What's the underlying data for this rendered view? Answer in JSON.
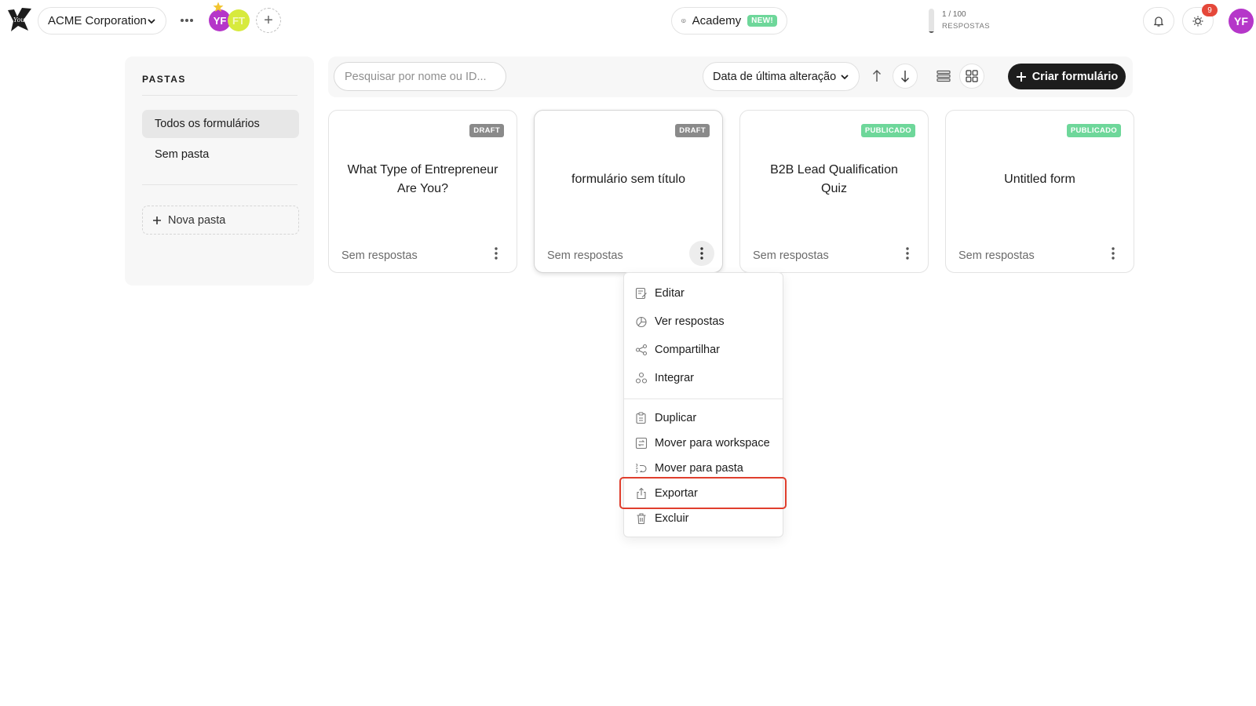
{
  "header": {
    "workspace_name": "ACME Corporation",
    "members": [
      {
        "initials": "YF",
        "color": "#b536c9"
      },
      {
        "initials": "FT",
        "color": "#d7ea3d"
      }
    ],
    "add_member_symbol": "+",
    "academy_label": "Academy",
    "academy_badge": "NEW!",
    "usage": {
      "count_text": "1 / 100",
      "label": "RESPOSTAS",
      "used": 1,
      "limit": 100
    },
    "notification_count": "9",
    "user_initials": "YF"
  },
  "folders": {
    "title": "PASTAS",
    "items": [
      {
        "label": "Todos os formulários",
        "active": true
      },
      {
        "label": "Sem pasta",
        "active": false
      }
    ],
    "new_folder_label": "Nova pasta"
  },
  "toolbar": {
    "search_placeholder": "Pesquisar por nome ou ID...",
    "sort_label": "Data de última alteração",
    "create_label": "Criar formulário"
  },
  "forms": [
    {
      "title": "What Type of Entrepreneur Are You?",
      "status": "DRAFT",
      "responses": "Sem respostas"
    },
    {
      "title": "formulário sem título",
      "status": "DRAFT",
      "responses": "Sem respostas"
    },
    {
      "title": "B2B Lead Qualification Quiz",
      "status": "PUBLICADO",
      "responses": "Sem respostas"
    },
    {
      "title": "Untitled form",
      "status": "PUBLICADO",
      "responses": "Sem respostas"
    }
  ],
  "context_menu": {
    "group1": [
      {
        "label": "Editar",
        "icon": "edit-icon"
      },
      {
        "label": "Ver respostas",
        "icon": "pie-chart-icon"
      },
      {
        "label": "Compartilhar",
        "icon": "share-icon"
      },
      {
        "label": "Integrar",
        "icon": "integrate-icon"
      }
    ],
    "group2": [
      {
        "label": "Duplicar",
        "icon": "duplicate-icon"
      },
      {
        "label": "Mover para workspace",
        "icon": "move-workspace-icon"
      },
      {
        "label": "Mover para pasta",
        "icon": "move-folder-icon"
      },
      {
        "label": "Exportar",
        "icon": "export-icon",
        "highlighted": true
      },
      {
        "label": "Excluir",
        "icon": "trash-icon"
      }
    ]
  },
  "colors": {
    "accent_dark": "#1d1d1d",
    "draft_badge": "#8a8a8a",
    "published_badge": "#6ed79a",
    "highlight": "#e03e2d",
    "avatar": "#b536c9"
  }
}
